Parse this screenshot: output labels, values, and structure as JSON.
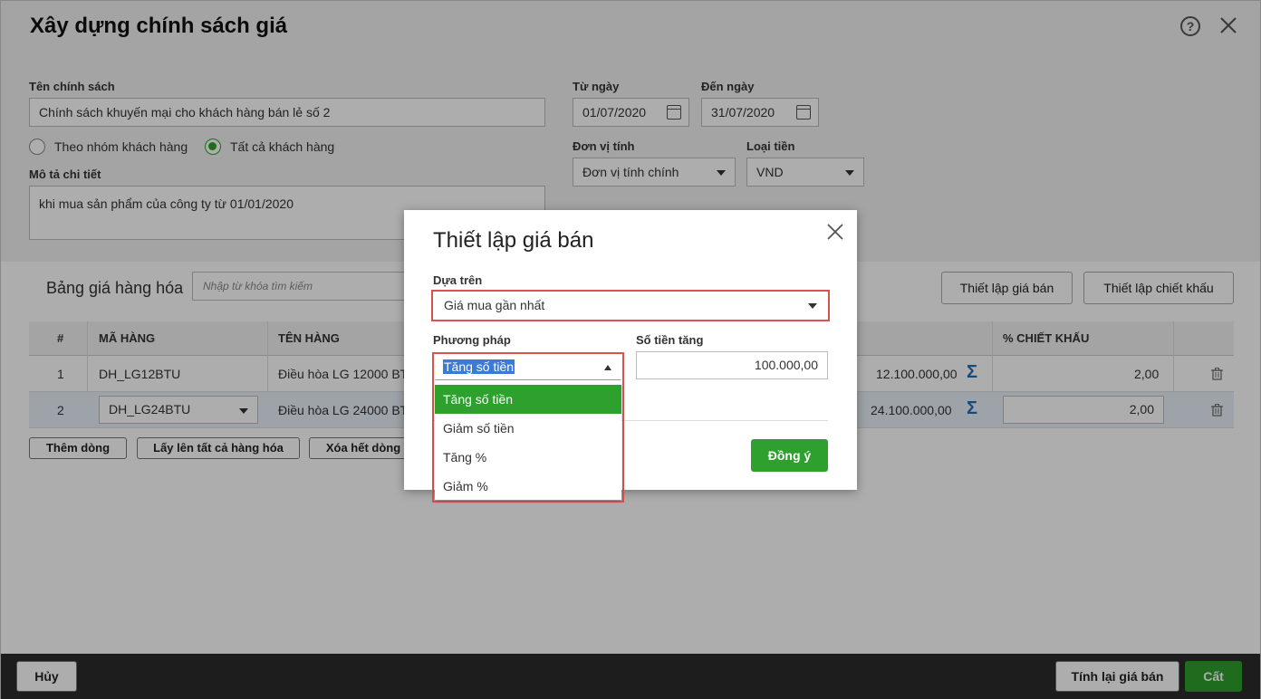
{
  "page": {
    "title": "Xây dựng chính sách giá",
    "policy_name_label": "Tên chính sách",
    "policy_name_value": "Chính sách khuyến mại cho khách hàng bán lẻ số 2",
    "radio_group_label": "Theo nhóm khách hàng",
    "radio_all_label": "Tất cả khách hàng",
    "radio_selected": "all",
    "description_label": "Mô tả chi tiết",
    "description_value": "khi mua sản phẩm của công ty từ 01/01/2020",
    "from_date_label": "Từ ngày",
    "from_date_value": "01/07/2020",
    "to_date_label": "Đến ngày",
    "to_date_value": "31/07/2020",
    "unit_label": "Đơn vị tính",
    "unit_value": "Đơn vị tính chính",
    "currency_label": "Loại tiền",
    "currency_value": "VND"
  },
  "price_table": {
    "title": "Bảng giá hàng hóa",
    "search_placeholder": "Nhập từ khóa tìm kiếm",
    "set_price_button": "Thiết lập giá bán",
    "set_discount_button": "Thiết lập chiết khấu",
    "columns": [
      "#",
      "MÃ HÀNG",
      "TÊN HÀNG",
      "% CHIẾT KHẤU"
    ],
    "rows": [
      {
        "index": "1",
        "code": "DH_LG12BTU",
        "name": "Điều hòa LG 12000 BTU",
        "price": "12.100.000,00",
        "discount": "2,00"
      },
      {
        "index": "2",
        "code": "DH_LG24BTU",
        "name": "Điều hòa LG 24000 BTU",
        "price": "24.100.000,00",
        "discount": "2,00"
      }
    ],
    "add_row_button": "Thêm dòng",
    "load_all_button": "Lấy lên tất cả hàng hóa",
    "clear_rows_button": "Xóa hết dòng"
  },
  "footer": {
    "cancel_button": "Hủy",
    "recalc_button": "Tính lại giá bán",
    "save_button": "Cất"
  },
  "dialog": {
    "title": "Thiết lập giá bán",
    "based_on_label": "Dựa trên",
    "based_on_value": "Giá mua gần nhất",
    "method_label": "Phương pháp",
    "method_value": "Tăng số tiền",
    "amount_label": "Số tiền tăng",
    "amount_value": "100.000,00",
    "ok_button": "Đồng ý",
    "method_options": [
      "Tăng số tiền",
      "Giảm số tiền",
      "Tăng %",
      "Giảm %"
    ]
  },
  "colors": {
    "accent_green": "#2ea02e",
    "highlight_red": "#d9534f",
    "sigma_blue": "#1e6fb8",
    "footer_dark": "#2b2b2b"
  },
  "icons": [
    "help-icon",
    "close-icon",
    "calendar-icon",
    "chevron-down-icon",
    "sigma-icon",
    "trash-icon"
  ]
}
